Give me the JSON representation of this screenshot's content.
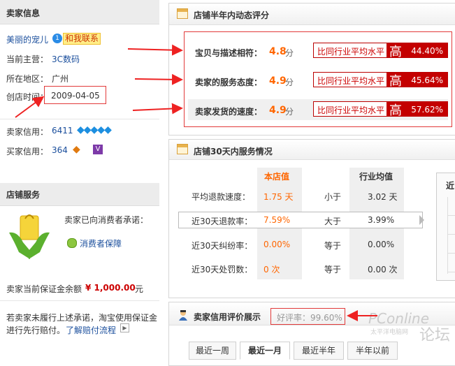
{
  "seller": {
    "title": "卖家信息",
    "name": "美丽的宠儿",
    "contact": "和我联系",
    "main_business_label": "当前主营：",
    "main_business": "3C数码",
    "region_label": "所在地区：",
    "region": "广州",
    "founded_label": "创店时间：",
    "founded": "2009-04-05",
    "seller_credit_label": "卖家信用：",
    "seller_credit": "6411",
    "buyer_credit_label": "买家信用：",
    "buyer_credit": "364"
  },
  "service": {
    "title": "店铺服务",
    "promise": "卖家已向消费者承诺：",
    "guarantee": "消费者保障",
    "deposit_label": "卖家当前保证金余额",
    "deposit": "¥ 1,000.00",
    "deposit_unit": "元",
    "note": "若卖家未履行上述承诺，淘宝使用保证金进行先行赔付。",
    "note_line1": "若卖家未履行上述承诺，淘宝使用保证金",
    "note_line2": "进行先行赔付。",
    "flow_link": "了解赔付流程"
  },
  "dsr": {
    "title": "店铺半年内动态评分",
    "compare_label": "比同行业平均水平",
    "high": "高",
    "unit": "分",
    "rows": [
      {
        "label": "宝贝与描述相符：",
        "score": "4.8",
        "pct": "44.40%"
      },
      {
        "label": "卖家的服务态度：",
        "score": "4.9",
        "pct": "45.64%"
      },
      {
        "label": "卖家发货的速度：",
        "score": "4.9",
        "pct": "57.62%"
      }
    ]
  },
  "service30": {
    "title": "店铺30天内服务情况",
    "col_store": "本店值",
    "col_avg": "行业均值",
    "side_label": "近",
    "rows": [
      {
        "label": "平均退款速度：",
        "store": "1.75 天",
        "cmp": "小于",
        "avg": "3.02 天"
      },
      {
        "label": "近30天退款率：",
        "store": "7.59%",
        "cmp": "大于",
        "avg": "3.99%"
      },
      {
        "label": "近30天纠纷率：",
        "store": "0.00%",
        "cmp": "等于",
        "avg": "0.00%"
      },
      {
        "label": "近30天处罚数：",
        "store": "0 次",
        "cmp": "等于",
        "avg": "0.00 次"
      }
    ]
  },
  "rating": {
    "title": "卖家信用评价展示",
    "good_rate": "好评率：99.60%",
    "tabs": [
      "最近一周",
      "最近一月",
      "最近半年",
      "半年以前"
    ],
    "active_tab": 1
  },
  "watermark": {
    "brand": "PConline",
    "sub": "太平洋电脑网",
    "forum": "论坛"
  },
  "colors": {
    "accent": "#ff6600",
    "price_red": "#cc0000",
    "link_blue": "#1a4e9c",
    "arrow_red": "#ee2222"
  }
}
